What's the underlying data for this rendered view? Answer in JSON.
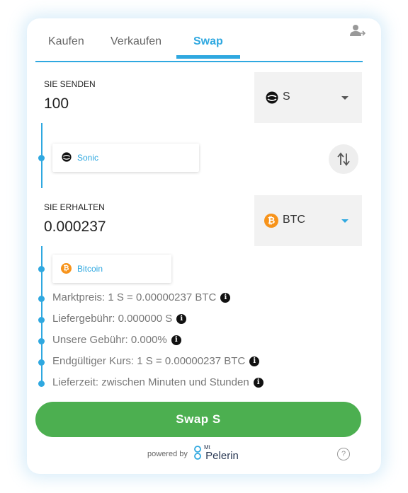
{
  "tabs": [
    {
      "label": "Kaufen"
    },
    {
      "label": "Verkaufen"
    },
    {
      "label": "Swap"
    }
  ],
  "send": {
    "label": "SIE SENDEN",
    "amount": "100",
    "currency": "S",
    "network": "Sonic"
  },
  "receive": {
    "label": "SIE ERHALTEN",
    "amount": "0.000237",
    "currency": "BTC",
    "network": "Bitcoin"
  },
  "details": [
    {
      "text": "Marktpreis: 1 S = 0.00000237 BTC"
    },
    {
      "text": "Liefergebühr: 0.000000 S"
    },
    {
      "text": "Unsere Gebühr: 0.000%"
    },
    {
      "text": "Endgültiger Kurs: 1 S = 0.00000237 BTC"
    },
    {
      "text": "Lieferzeit: zwischen Minuten und Stunden"
    }
  ],
  "action_button": "Swap S",
  "footer": {
    "powered_by": "powered by",
    "brand_small": "Mt",
    "brand": "Pelerin"
  },
  "colors": {
    "accent": "#2fa8e0",
    "button": "#4caf50",
    "btc": "#f7931a"
  },
  "icons": {
    "user": "user-switch-icon",
    "sonic": "sonic-logo-icon",
    "btc": "bitcoin-logo-icon",
    "swap": "swap-arrows-icon",
    "info": "info-icon",
    "help": "help-icon"
  }
}
